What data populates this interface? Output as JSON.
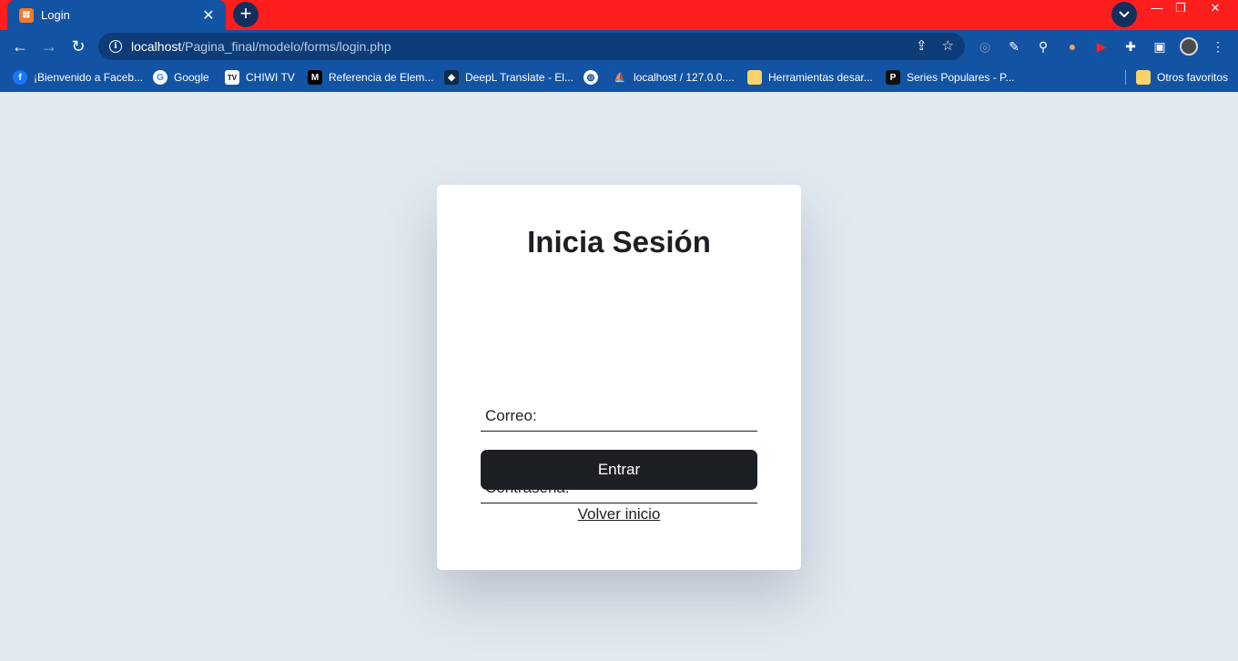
{
  "browser": {
    "tab": {
      "title": "Login",
      "favicon_icon": "xampp-icon"
    },
    "url_host": "localhost",
    "url_path": "/Pagina_final/modelo/forms/login.php",
    "bookmarks": [
      {
        "label": "¡Bienvenido a Faceb...",
        "icon": "facebook-icon",
        "color": "#1877f2"
      },
      {
        "label": "Google",
        "icon": "google-icon",
        "color": "#ffffff"
      },
      {
        "label": "CHIWI TV",
        "icon": "tv-icon",
        "color": "#ffffff"
      },
      {
        "label": "Referencia de Elem...",
        "icon": "mdn-icon",
        "color": "#000000"
      },
      {
        "label": "DeepL Translate - El...",
        "icon": "deepl-icon",
        "color": "#0f2b46"
      },
      {
        "label": "",
        "icon": "globe-icon",
        "color": "#ffffff"
      },
      {
        "label": "localhost / 127.0.0....",
        "icon": "phpmyadmin-icon",
        "color": "#f29111"
      },
      {
        "label": "Herramientas desar...",
        "icon": "folder-icon",
        "color": "#f6d46b"
      },
      {
        "label": "Series Populares - P...",
        "icon": "p-icon",
        "color": "#111111"
      }
    ],
    "other_bookmarks": "Otros favoritos"
  },
  "login": {
    "title": "Inicia Sesión",
    "email_label": "Correo:",
    "password_label": "Contraseña:",
    "submit_label": "Entrar",
    "back_label": "Volver inicio"
  },
  "colors": {
    "tabbar": "#ff1e1e",
    "chrome": "#1353a3",
    "page_bg": "#e3e9f1",
    "button": "#1c1f24"
  }
}
